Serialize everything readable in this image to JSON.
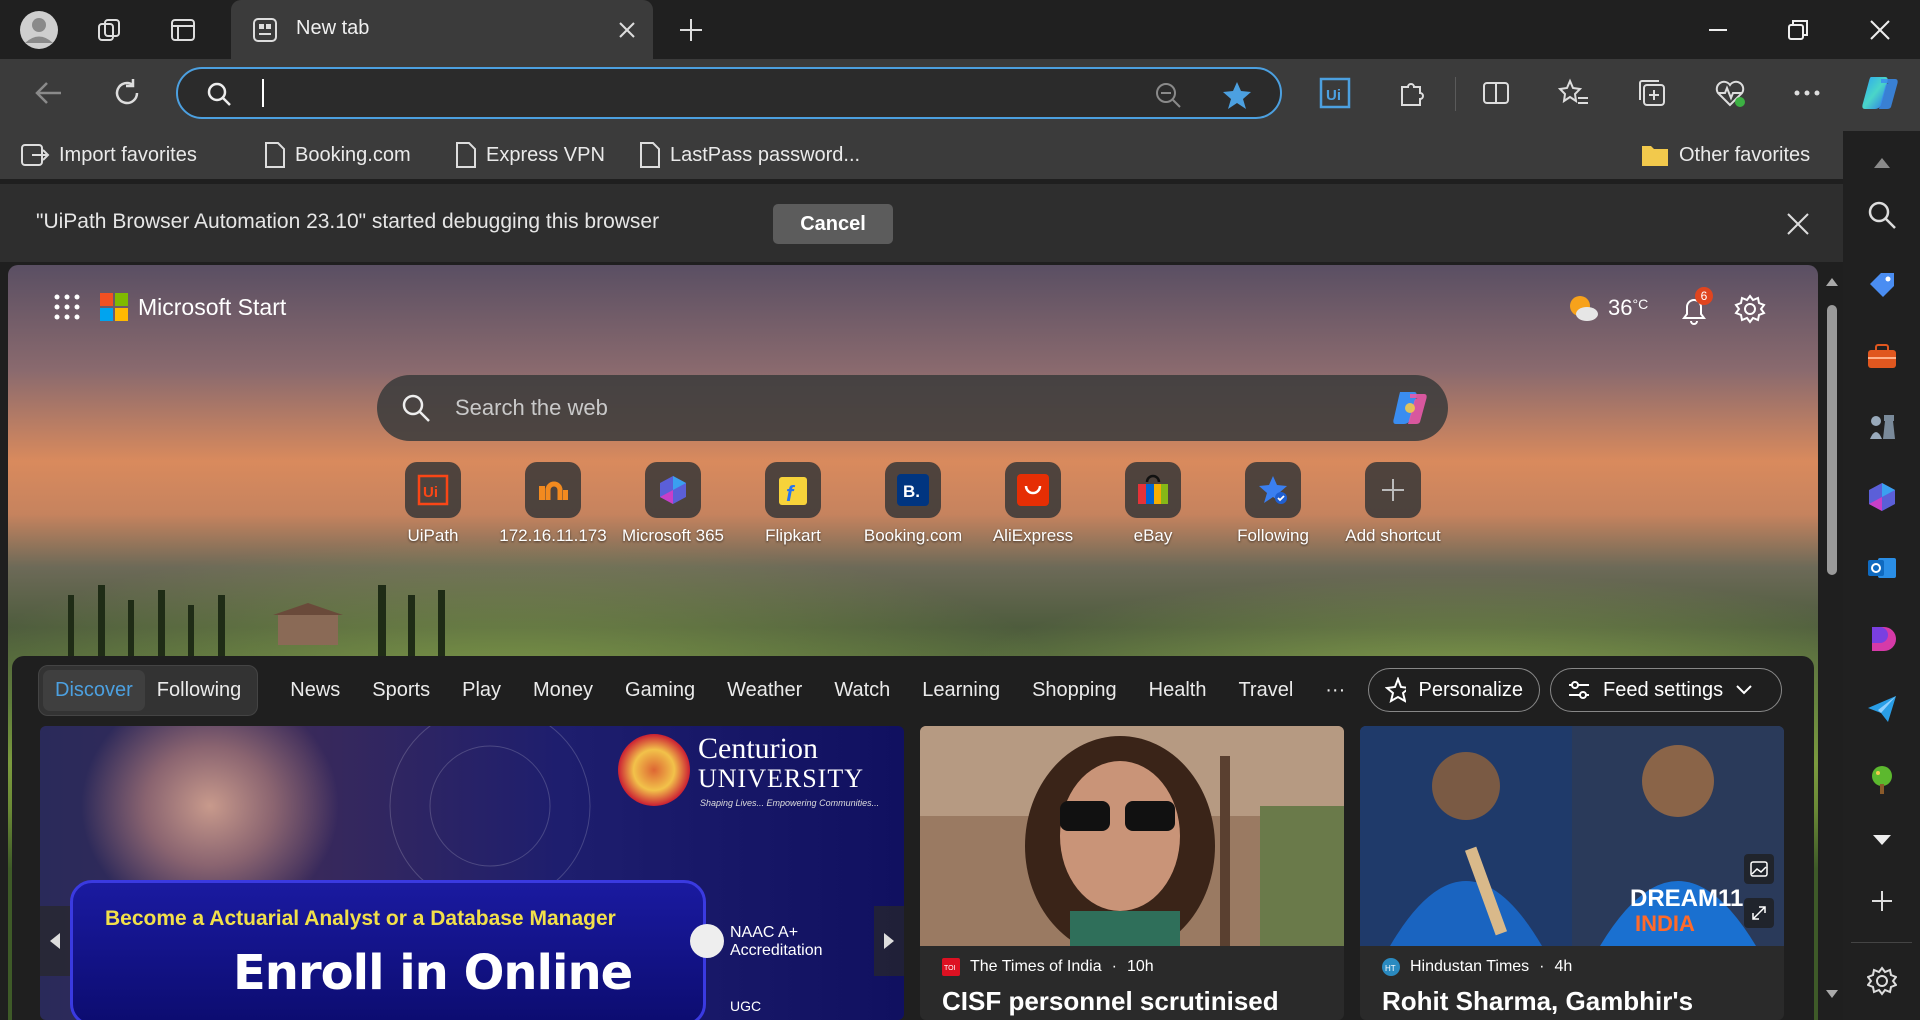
{
  "browser": {
    "tab_title": "New tab",
    "address_value": ""
  },
  "favorites": {
    "import_label": "Import favorites",
    "items": [
      "Booking.com",
      "Express VPN",
      "LastPass password..."
    ],
    "other_label": "Other favorites"
  },
  "debug_bar": {
    "message": "\"UiPath Browser Automation 23.10\" started debugging this browser",
    "cancel_label": "Cancel"
  },
  "start_page": {
    "brand": "Microsoft Start",
    "temperature": "36",
    "temp_unit": "°C",
    "notification_count": "6",
    "search_placeholder": "Search the web",
    "shortcuts": [
      "UiPath",
      "172.16.11.173",
      "Microsoft 365",
      "Flipkart",
      "Booking.com",
      "AliExpress",
      "eBay",
      "Following",
      "Add shortcut"
    ]
  },
  "feed": {
    "pill_tabs": [
      "Discover",
      "Following"
    ],
    "tabs": [
      "News",
      "Sports",
      "Play",
      "Money",
      "Gaming",
      "Weather",
      "Watch",
      "Learning",
      "Shopping",
      "Health",
      "Travel",
      "···"
    ],
    "personalize_label": "Personalize",
    "feed_settings_label": "Feed settings",
    "hero": {
      "subline": "Become a Actuarial Analyst or a Database Manager",
      "headline": "Enroll in Online",
      "brand_name": "Centurion",
      "brand_university": "UNIVERSITY",
      "brand_tagline": "Shaping Lives... Empowering Communities...",
      "naac_line1": "NAAC A+",
      "naac_line2": "Accreditation",
      "ugc": "UGC"
    },
    "cards": [
      {
        "source": "The Times of India",
        "time": "10h",
        "title": "CISF personnel scrutinised"
      },
      {
        "source": "Hindustan Times",
        "time": "4h",
        "title": "Rohit Sharma, Gambhir's"
      }
    ]
  },
  "colors": {
    "accent": "#4ca0e0",
    "titlebar": "#202020",
    "toolbar": "#3b3b3b",
    "badge": "#e0451f"
  }
}
